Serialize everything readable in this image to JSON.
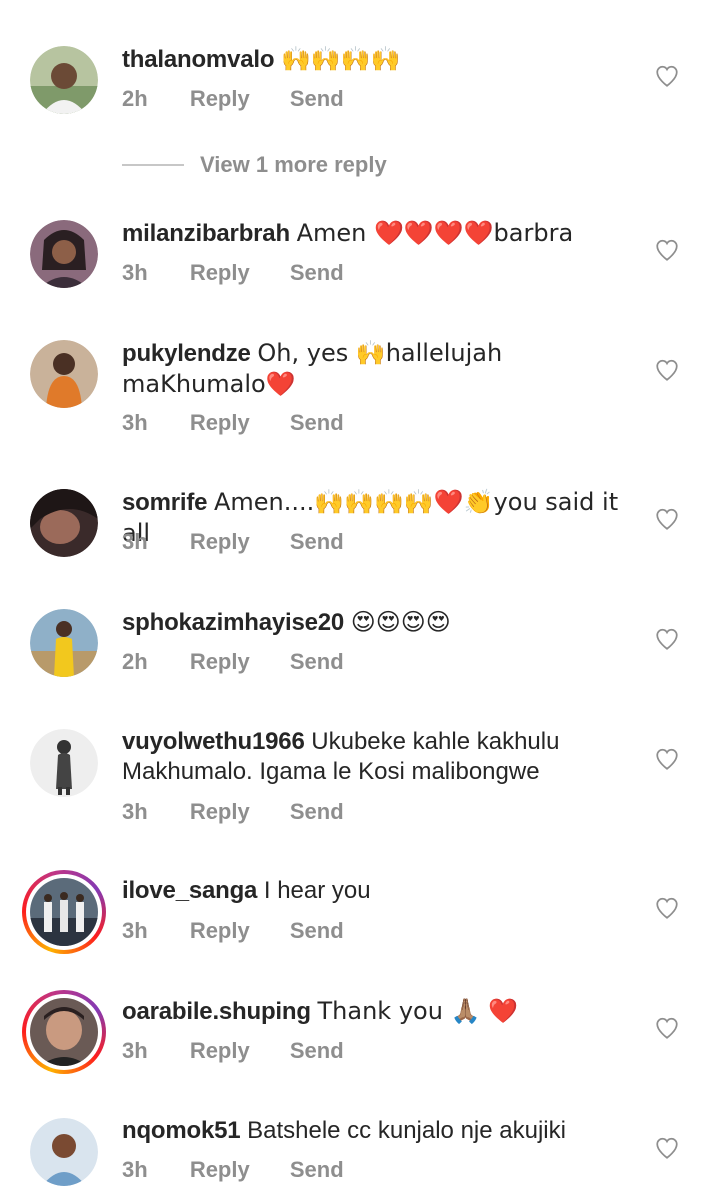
{
  "actions": {
    "reply": "Reply",
    "send": "Send"
  },
  "view_more": "View 1 more reply",
  "comments": [
    {
      "username": "thalanomvalo",
      "text": "🙌🙌🙌🙌",
      "time": "2h",
      "avatar_color": "#7f9a6a"
    },
    {
      "username": "milanzibarbrah",
      "text": "Amen ❤️❤️❤️❤️barbra",
      "time": "3h",
      "avatar_color": "#6b4c5f"
    },
    {
      "username": "pukylendze",
      "text": "Oh, yes 🙌hallelujah maKhumalo❤️",
      "time": "3h",
      "avatar_color": "#d87a32"
    },
    {
      "username": "somrife",
      "text": "Amen....🙌🙌🙌🙌❤️👏you said it all",
      "time": "3h",
      "avatar_color": "#5a3b3a"
    },
    {
      "username": "sphokazimhayise20",
      "text": "😍😍😍😍",
      "time": "2h",
      "avatar_color": "#c9a23a"
    },
    {
      "username": "vuyolwethu1966",
      "text": "Ukubeke kahle kakhulu Makhumalo. Igama le Kosi malibongwe",
      "time": "3h",
      "avatar_color": "#d9d9d9"
    },
    {
      "username": "ilove_sanga",
      "text": "I hear you",
      "time": "3h",
      "avatar_color": "#3d4a5c"
    },
    {
      "username": "oarabile.shuping",
      "text": "Thank you 🙏🏽 ❤️",
      "time": "3h",
      "avatar_color": "#6a5a55"
    },
    {
      "username": "nqomok51",
      "text": "Batshele cc kunjalo nje akujiki",
      "time": "3h",
      "avatar_color": "#9fb5c9"
    }
  ]
}
